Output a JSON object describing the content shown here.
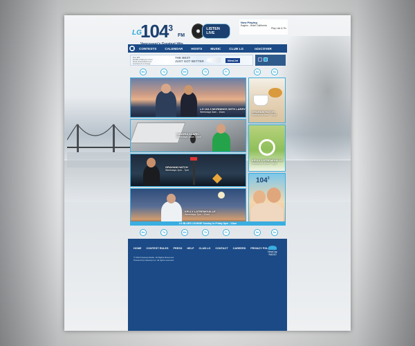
{
  "brand": {
    "prefix": "LG",
    "number": "104",
    "decimal": "3",
    "band": "FM",
    "tagline": "Vancouver's Greatest Hits"
  },
  "listen_live": {
    "label": "LISTEN LIVE"
  },
  "now_playing": {
    "title": "Now Playing",
    "track": "Eagles - Hotel California",
    "next": "Play List & Tix"
  },
  "nav": {
    "items": [
      "CONTESTS",
      "CALENDAR",
      "HOSTS",
      "MUSIC",
      "CLUB LG",
      "minCOVER"
    ]
  },
  "ad": {
    "lines": [
      "Free Wifi",
      "Flexible seating & no fees",
      "Fixed, Reasonable Fees",
      "Low fares & no change"
    ],
    "headline_1": "THE BEST",
    "headline_2": "JUST GOT BETTER",
    "brand": "WestJet"
  },
  "days": [
    "Mo",
    "Tu",
    "We",
    "Th",
    "Fr",
    "Sa",
    "Su"
  ],
  "shows": [
    {
      "title": "LG 104.3 MORNINGS WITH LARRY",
      "time": "Weekdays 5am - 10am"
    },
    {
      "title": "SANDRA KLARIC",
      "time": "Weekdays 10am - 2pm"
    },
    {
      "title": "GRAHAM HATCH",
      "time": "Weekdays 2pm - 7pm"
    },
    {
      "title": "KELLY LATREMOUILLE",
      "time": "Weekdays 7pm - 12am"
    }
  ],
  "side_shows": [
    {
      "title": "GRAHAM HATCH",
      "time": "Weekends 6am - 10am"
    },
    {
      "title": "KELLY LATREMOUILLE",
      "time": "Weekends 10am - 3pm"
    }
  ],
  "bar_caption": "LG BLUES LOUNGE  Sunday to Friday 8pm - 12am",
  "footer": {
    "links": [
      "HOME",
      "CONTEST RULES",
      "PRESS",
      "HELP",
      "CLUB LG",
      "CONTACT",
      "CAREERS",
      "PRIVACY POLICY"
    ],
    "copyright_1": "© 2014 Newcap Radio. All Rights Reserved.",
    "copyright_2": "Powered by Newcap Inc. All rights reserved.",
    "company": "NewCap",
    "company_sub": "RADIO"
  }
}
